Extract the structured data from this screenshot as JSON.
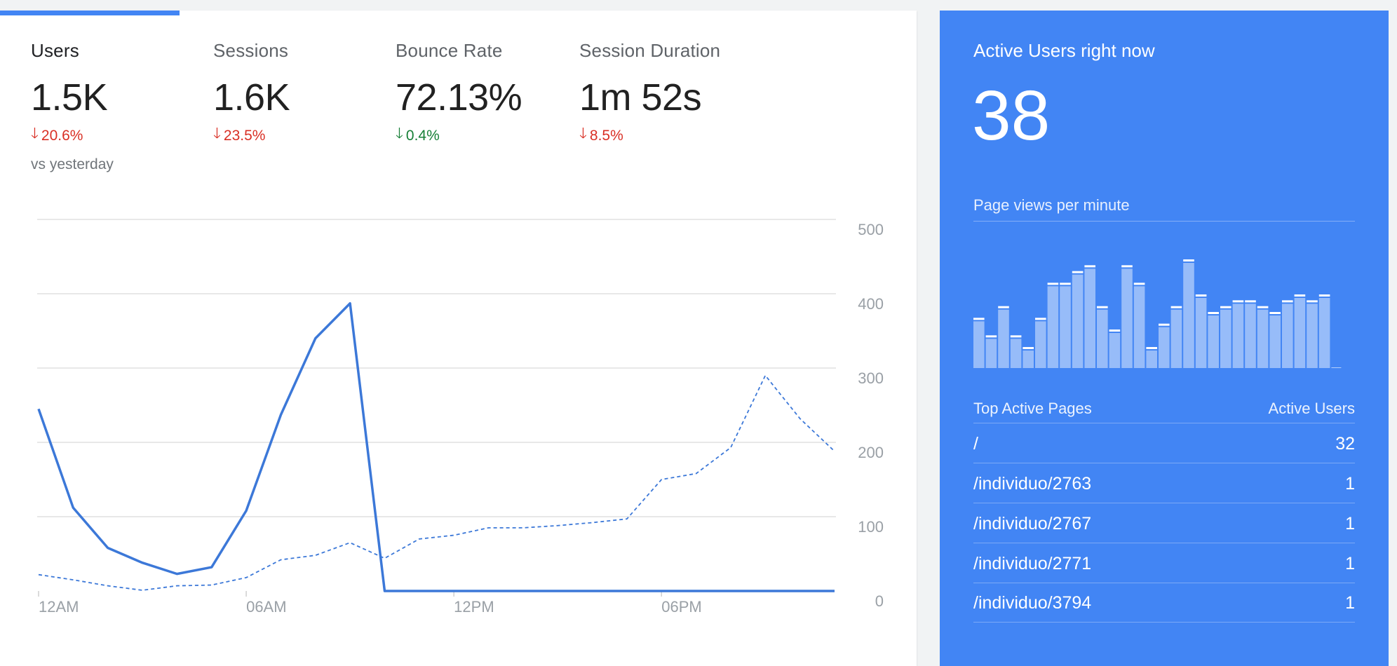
{
  "metrics": [
    {
      "label": "Users",
      "value": "1.5K",
      "change": "20.6%",
      "direction": "down",
      "sentiment": "bad",
      "active": true
    },
    {
      "label": "Sessions",
      "value": "1.6K",
      "change": "23.5%",
      "direction": "down",
      "sentiment": "bad",
      "active": false
    },
    {
      "label": "Bounce Rate",
      "value": "72.13%",
      "change": "0.4%",
      "direction": "down",
      "sentiment": "good",
      "active": false
    },
    {
      "label": "Session Duration",
      "value": "1m 52s",
      "change": "8.5%",
      "direction": "down",
      "sentiment": "bad",
      "active": false
    }
  ],
  "vs_text": "vs yesterday",
  "colors": {
    "accent": "#4285f4",
    "bad": "#d93025",
    "good": "#188038",
    "line": "#3c78d8"
  },
  "chart_data": {
    "type": "line",
    "x": [
      0,
      1,
      2,
      3,
      4,
      5,
      6,
      7,
      8,
      9,
      10,
      11,
      12,
      13,
      14,
      15,
      16,
      17,
      18,
      19,
      20,
      21,
      22,
      23
    ],
    "xticks": [
      {
        "x": 0,
        "label": "12AM"
      },
      {
        "x": 6,
        "label": "06AM"
      },
      {
        "x": 12,
        "label": "12PM"
      },
      {
        "x": 18,
        "label": "06PM"
      }
    ],
    "yticks": [
      "0",
      "100",
      "200",
      "300",
      "400",
      "500"
    ],
    "ylim": [
      0,
      500
    ],
    "xlim": [
      0,
      23
    ],
    "series": [
      {
        "style": "solid",
        "values": [
          245,
          112,
          58,
          38,
          23,
          32,
          108,
          237,
          340,
          387,
          0,
          0,
          0,
          0,
          0,
          0,
          0,
          0,
          0,
          0,
          0,
          0,
          0,
          0
        ]
      },
      {
        "style": "dashed",
        "values": [
          22,
          15,
          7,
          1,
          7,
          8,
          18,
          42,
          48,
          65,
          44,
          70,
          75,
          85,
          85,
          88,
          92,
          97,
          150,
          158,
          193,
          290,
          232,
          188
        ]
      }
    ]
  },
  "realtime": {
    "title": "Active Users right now",
    "count": "38",
    "pv_label": "Page views per minute",
    "pv_values": [
      8,
      5,
      10,
      5,
      3,
      8,
      14,
      14,
      16,
      17,
      10,
      6,
      17,
      14,
      3,
      7,
      10,
      18,
      12,
      9,
      10,
      11,
      11,
      10,
      9,
      11,
      12,
      11,
      12
    ],
    "top_pages_header": "Top Active Pages",
    "active_users_header": "Active Users",
    "top_pages": [
      {
        "path": "/",
        "users": "32"
      },
      {
        "path": "/individuo/2763",
        "users": "1"
      },
      {
        "path": "/individuo/2767",
        "users": "1"
      },
      {
        "path": "/individuo/2771",
        "users": "1"
      },
      {
        "path": "/individuo/3794",
        "users": "1"
      }
    ]
  }
}
